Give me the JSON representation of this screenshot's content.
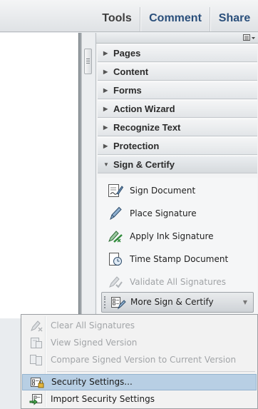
{
  "toolbar": {
    "tools_label": "Tools",
    "comment_label": "Comment",
    "share_label": "Share"
  },
  "panel": {
    "sections": [
      {
        "label": "Pages",
        "expanded": false
      },
      {
        "label": "Content",
        "expanded": false
      },
      {
        "label": "Forms",
        "expanded": false
      },
      {
        "label": "Action Wizard",
        "expanded": false
      },
      {
        "label": "Recognize Text",
        "expanded": false
      },
      {
        "label": "Protection",
        "expanded": false
      },
      {
        "label": "Sign & Certify",
        "expanded": true
      }
    ],
    "sign_items": [
      {
        "label": "Sign Document",
        "icon": "sign-document-icon",
        "enabled": true
      },
      {
        "label": "Place Signature",
        "icon": "pen-icon",
        "enabled": true
      },
      {
        "label": "Apply Ink Signature",
        "icon": "ink-signature-icon",
        "enabled": true
      },
      {
        "label": "Time Stamp Document",
        "icon": "time-stamp-icon",
        "enabled": true
      },
      {
        "label": "Validate All Signatures",
        "icon": "validate-signatures-icon",
        "enabled": false
      }
    ],
    "more_label": "More Sign & Certify"
  },
  "menu": {
    "items": [
      {
        "label": "Clear All Signatures",
        "icon": "clear-signatures-icon",
        "enabled": false
      },
      {
        "label": "View Signed Version",
        "icon": "view-signed-icon",
        "enabled": false
      },
      {
        "label": "Compare Signed Version to Current Version",
        "icon": "compare-versions-icon",
        "enabled": false
      },
      {
        "label": "Security Settings...",
        "icon": "security-settings-icon",
        "enabled": true,
        "highlighted": true
      },
      {
        "label": "Import Security Settings",
        "icon": "import-settings-icon",
        "enabled": true
      }
    ]
  },
  "colors": {
    "accent_text": "#2a4f7b",
    "menu_highlight": "#b8cfe4",
    "disabled_text": "#a2a5a8"
  }
}
